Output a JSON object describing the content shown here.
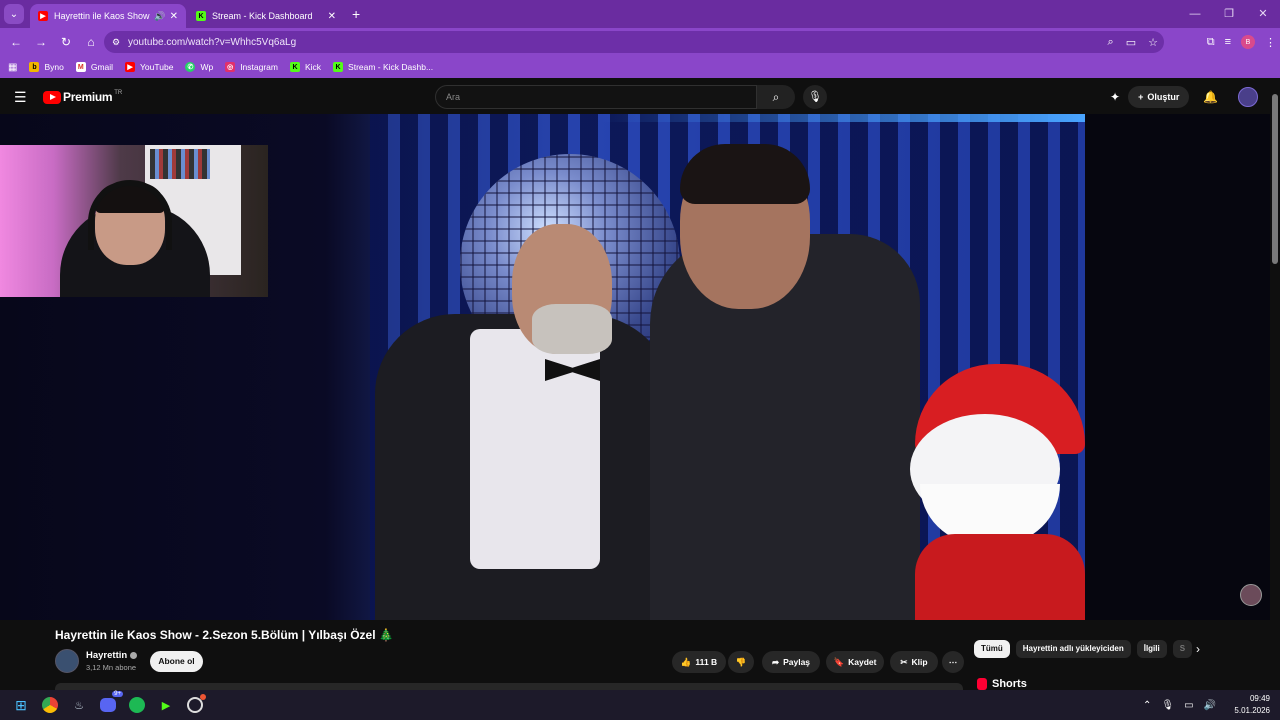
{
  "browser": {
    "tabs": [
      {
        "title": "Hayrettin ile Kaos Show - 2.",
        "active": true,
        "favicon": "youtube-icon"
      },
      {
        "title": "Stream - Kick Dashboard",
        "active": false,
        "favicon": "kick-icon"
      }
    ],
    "url": "youtube.com/watch?v=Whhc5Vq6aLg",
    "profile_initial": "B",
    "bookmarks": [
      {
        "label": "Byno",
        "icon": "byno-icon"
      },
      {
        "label": "Gmail",
        "icon": "gmail-icon"
      },
      {
        "label": "YouTube",
        "icon": "youtube-icon"
      },
      {
        "label": "Wp",
        "icon": "whatsapp-icon"
      },
      {
        "label": "Instagram",
        "icon": "instagram-icon"
      },
      {
        "label": "Kick",
        "icon": "kick-icon"
      },
      {
        "label": "Stream - Kick Dashb...",
        "icon": "kick-icon"
      }
    ]
  },
  "youtube": {
    "brand": "Premium",
    "region": "TR",
    "search_placeholder": "Ara",
    "create_label": "Oluştur",
    "video": {
      "title": "Hayrettin ile Kaos Show - 2.Sezon 5.Bölüm | Yılbaşı Özel 🎄",
      "channel": "Hayrettin",
      "subscribers": "3,12 Mn abone",
      "subscribe_label": "Abone ol",
      "likes": "111 B",
      "share_label": "Paylaş",
      "save_label": "Kaydet",
      "clip_label": "Klip"
    },
    "chips": [
      "Tümü",
      "Hayrettin adlı yükleyiciden",
      "İlgili",
      "S"
    ],
    "shorts_label": "Shorts"
  },
  "taskbar": {
    "discord_badge": "9+",
    "time": "09:49",
    "date": "5.01.2026"
  },
  "colors": {
    "chrome_tabbar": "#6a2ca0",
    "chrome_toolbar": "#8a46c9",
    "yt_bg": "#0f0f0f",
    "yt_red": "#ff0000"
  }
}
